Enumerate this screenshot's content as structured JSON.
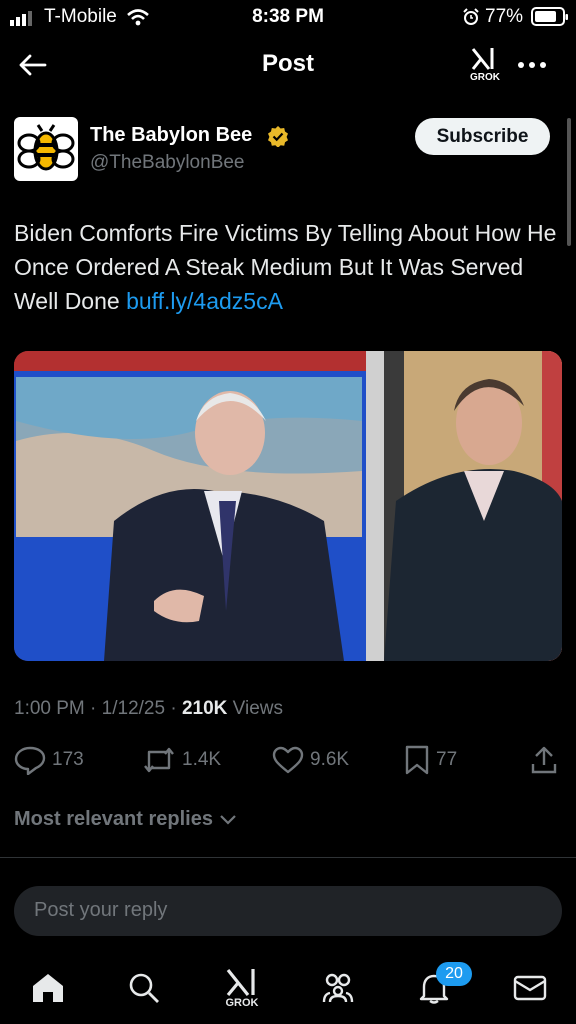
{
  "status_bar": {
    "carrier": "T-Mobile",
    "time": "8:38 PM",
    "battery": "77%"
  },
  "header": {
    "title": "Post",
    "grok_label": "GROK"
  },
  "post": {
    "author_name": "The Babylon Bee",
    "author_handle": "@TheBabylonBee",
    "subscribe_label": "Subscribe",
    "text": "Biden Comforts Fire Victims By Telling About How He Once Ordered A Steak Medium But It Was Served Well Done ",
    "link": "buff.ly/4adz5cA",
    "time": "1:00 PM",
    "date": "1/12/25",
    "views": "210K",
    "views_label": "Views"
  },
  "actions": {
    "replies": "173",
    "reposts": "1.4K",
    "likes": "9.6K",
    "bookmarks": "77"
  },
  "replies_sort": "Most relevant replies",
  "reply_placeholder": "Post your reply",
  "tab_bar": {
    "grok_label": "GROK",
    "notifications_badge": "20"
  },
  "colors": {
    "accent": "#1d9bf0",
    "verified_gold": "#e8b829",
    "background": "#000000"
  }
}
